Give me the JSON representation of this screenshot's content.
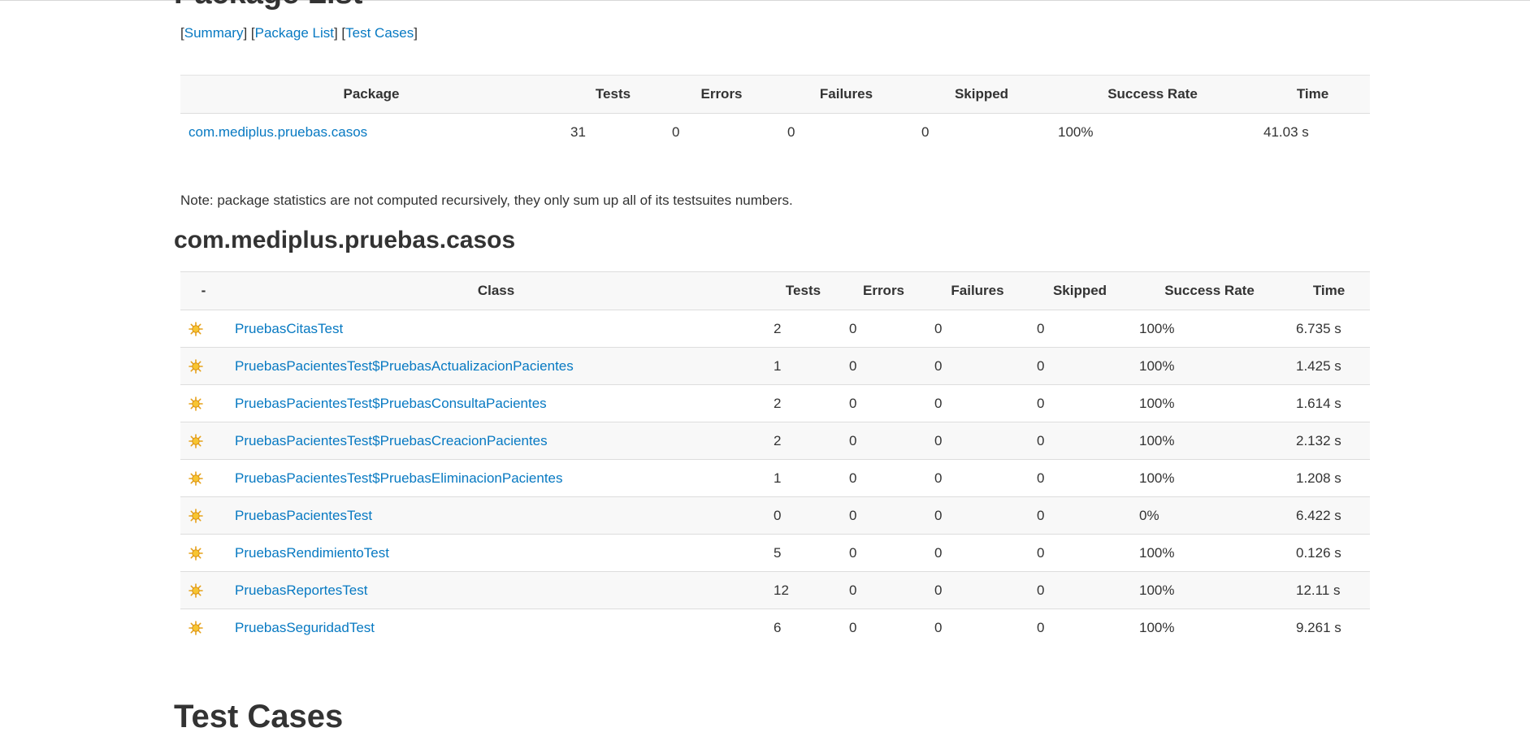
{
  "package_list": {
    "title": "Package List",
    "nav": {
      "summary": "Summary",
      "package_list": "Package List",
      "test_cases": "Test Cases"
    },
    "headers": [
      "Package",
      "Tests",
      "Errors",
      "Failures",
      "Skipped",
      "Success Rate",
      "Time"
    ],
    "rows": [
      {
        "package": "com.mediplus.pruebas.casos",
        "tests": "31",
        "errors": "0",
        "failures": "0",
        "skipped": "0",
        "success_rate": "100%",
        "time": "41.03 s"
      }
    ],
    "note": "Note: package statistics are not computed recursively, they only sum up all of its testsuites numbers."
  },
  "package_section": {
    "title": "com.mediplus.pruebas.casos",
    "headers": [
      "-",
      "Class",
      "Tests",
      "Errors",
      "Failures",
      "Skipped",
      "Success Rate",
      "Time"
    ],
    "row_icon": "test-class-sun-icon",
    "rows": [
      {
        "class": "PruebasCitasTest",
        "tests": "2",
        "errors": "0",
        "failures": "0",
        "skipped": "0",
        "success_rate": "100%",
        "time": "6.735 s"
      },
      {
        "class": "PruebasPacientesTest$PruebasActualizacionPacientes",
        "tests": "1",
        "errors": "0",
        "failures": "0",
        "skipped": "0",
        "success_rate": "100%",
        "time": "1.425 s"
      },
      {
        "class": "PruebasPacientesTest$PruebasConsultaPacientes",
        "tests": "2",
        "errors": "0",
        "failures": "0",
        "skipped": "0",
        "success_rate": "100%",
        "time": "1.614 s"
      },
      {
        "class": "PruebasPacientesTest$PruebasCreacionPacientes",
        "tests": "2",
        "errors": "0",
        "failures": "0",
        "skipped": "0",
        "success_rate": "100%",
        "time": "2.132 s"
      },
      {
        "class": "PruebasPacientesTest$PruebasEliminacionPacientes",
        "tests": "1",
        "errors": "0",
        "failures": "0",
        "skipped": "0",
        "success_rate": "100%",
        "time": "1.208 s"
      },
      {
        "class": "PruebasPacientesTest",
        "tests": "0",
        "errors": "0",
        "failures": "0",
        "skipped": "0",
        "success_rate": "0%",
        "time": "6.422 s"
      },
      {
        "class": "PruebasRendimientoTest",
        "tests": "5",
        "errors": "0",
        "failures": "0",
        "skipped": "0",
        "success_rate": "100%",
        "time": "0.126 s"
      },
      {
        "class": "PruebasReportesTest",
        "tests": "12",
        "errors": "0",
        "failures": "0",
        "skipped": "0",
        "success_rate": "100%",
        "time": "12.11 s"
      },
      {
        "class": "PruebasSeguridadTest",
        "tests": "6",
        "errors": "0",
        "failures": "0",
        "skipped": "0",
        "success_rate": "100%",
        "time": "9.261 s"
      }
    ]
  },
  "test_cases": {
    "title": "Test Cases"
  },
  "colors": {
    "link": "#0779c2",
    "text": "#333333",
    "header_bg": "#f8f8f8",
    "border": "#dddddd"
  }
}
